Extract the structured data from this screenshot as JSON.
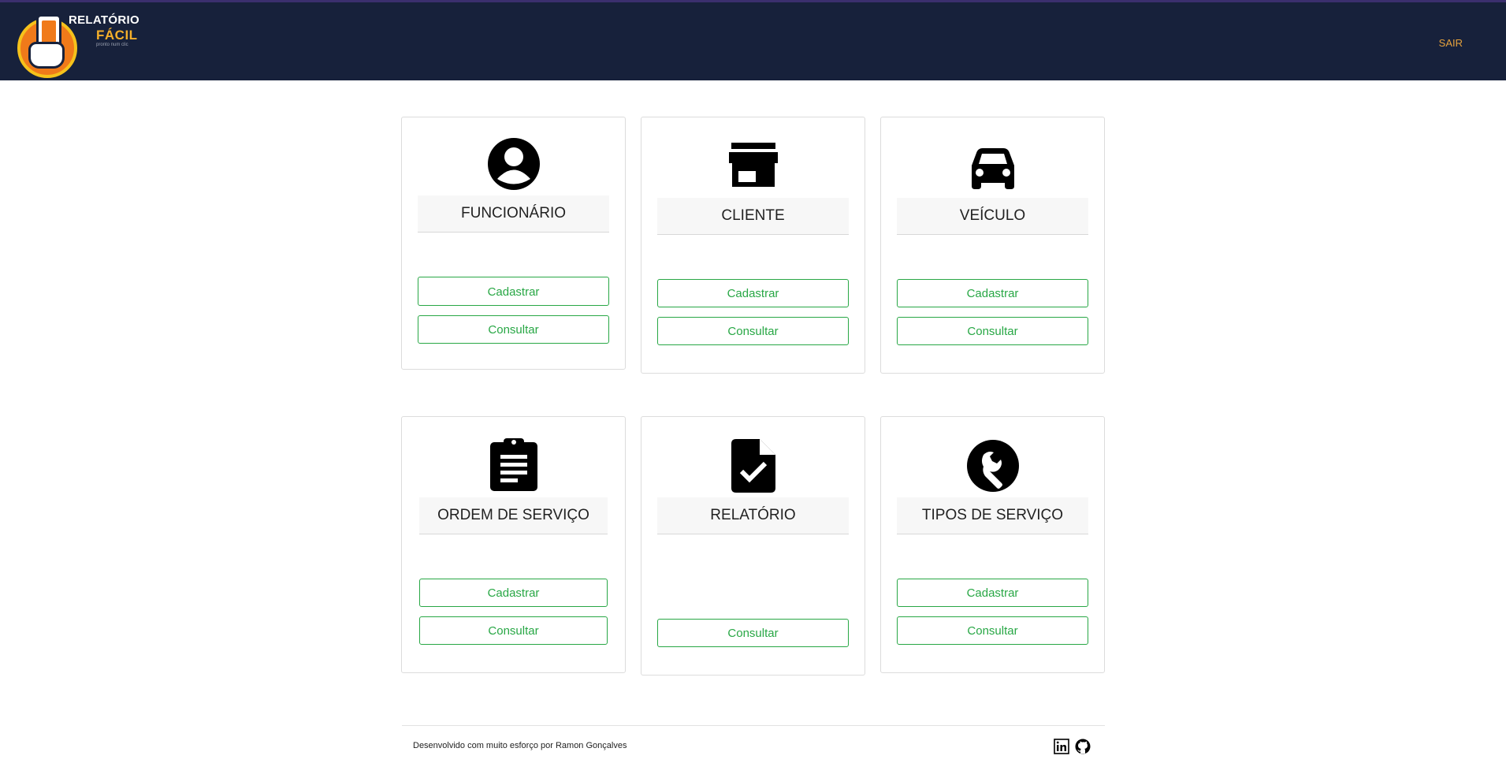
{
  "header": {
    "logo_line1": "RELATÓRIO",
    "logo_line2": "FÁCIL",
    "logo_tagline": "pronto num clic",
    "logout_label": "SAIR"
  },
  "cards": [
    {
      "title": "FUNCIONÁRIO",
      "icon": "user-circle-icon",
      "register_label": "Cadastrar",
      "consult_label": "Consultar"
    },
    {
      "title": "CLIENTE",
      "icon": "store-icon",
      "register_label": "Cadastrar",
      "consult_label": "Consultar"
    },
    {
      "title": "VEÍCULO",
      "icon": "car-icon",
      "register_label": "Cadastrar",
      "consult_label": "Consultar"
    },
    {
      "title": "ORDEM DE SERVIÇO",
      "icon": "clipboard-icon",
      "register_label": "Cadastrar",
      "consult_label": "Consultar"
    },
    {
      "title": "RELATÓRIO",
      "icon": "document-check-icon",
      "consult_label": "Consultar"
    },
    {
      "title": "TIPOS DE SERVIÇO",
      "icon": "wrench-icon",
      "register_label": "Cadastrar",
      "consult_label": "Consultar"
    }
  ],
  "footer": {
    "credit": "Desenvolvido com muito esforço por Ramon Gonçalves",
    "links": [
      {
        "icon": "linkedin-icon"
      },
      {
        "icon": "github-icon"
      }
    ]
  },
  "colors": {
    "navbar_bg": "#17213b",
    "accent_green": "#28a745",
    "logout_orange": "#e6a23c",
    "logo_orange": "#f07a1a",
    "logo_yellow": "#f6c21b"
  }
}
